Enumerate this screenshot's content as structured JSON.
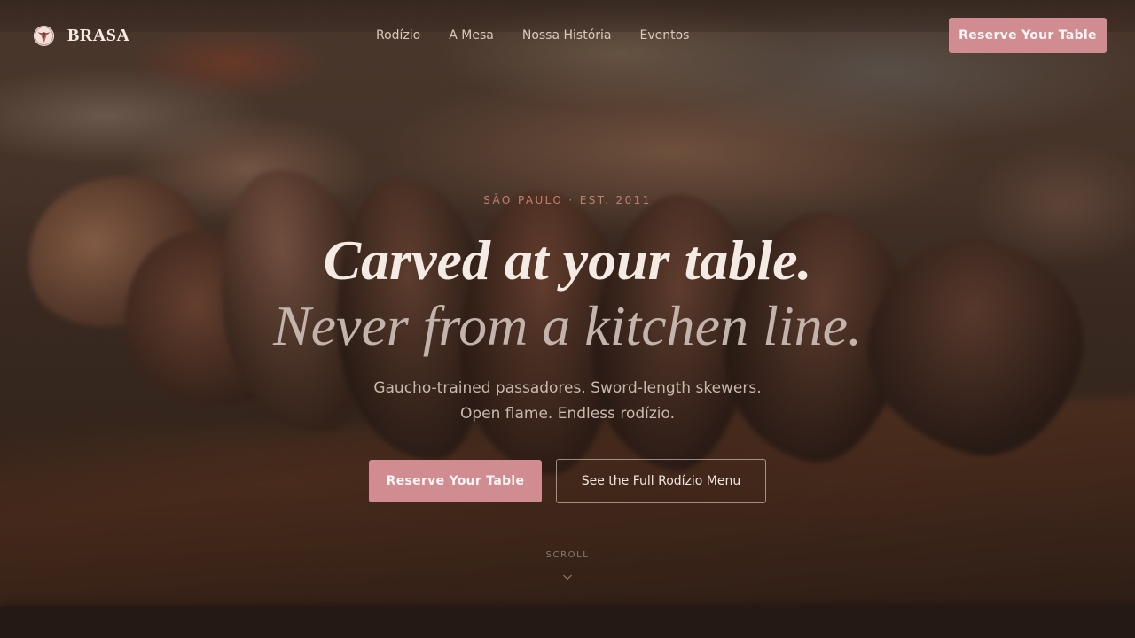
{
  "brand": {
    "name": "BRASA",
    "logo_icon": "steer-head-icon"
  },
  "nav": {
    "items": [
      {
        "label": "Rodízio"
      },
      {
        "label": "A Mesa"
      },
      {
        "label": "Nossa História"
      },
      {
        "label": "Eventos"
      }
    ]
  },
  "header": {
    "cta_label": "Reserve Your Table"
  },
  "hero": {
    "eyebrow": "SÃO PAULO · EST. 2011",
    "headline_line1": "Carved at your table.",
    "headline_line2": "Never from a kitchen line.",
    "subtitle_line1": "Gaucho-trained passadores. Sword-length skewers.",
    "subtitle_line2": "Open flame. Endless rodízio.",
    "primary_cta": "Reserve Your Table",
    "secondary_cta": "See the Full Rodízio Menu",
    "scroll_label": "SCROLL",
    "scroll_icon": "chevron-down-icon",
    "background": "blurred-sliced-steak-photo"
  },
  "colors": {
    "accent": "#d18c92",
    "eyebrow": "#c27f6f",
    "background": "#2a1d17"
  }
}
